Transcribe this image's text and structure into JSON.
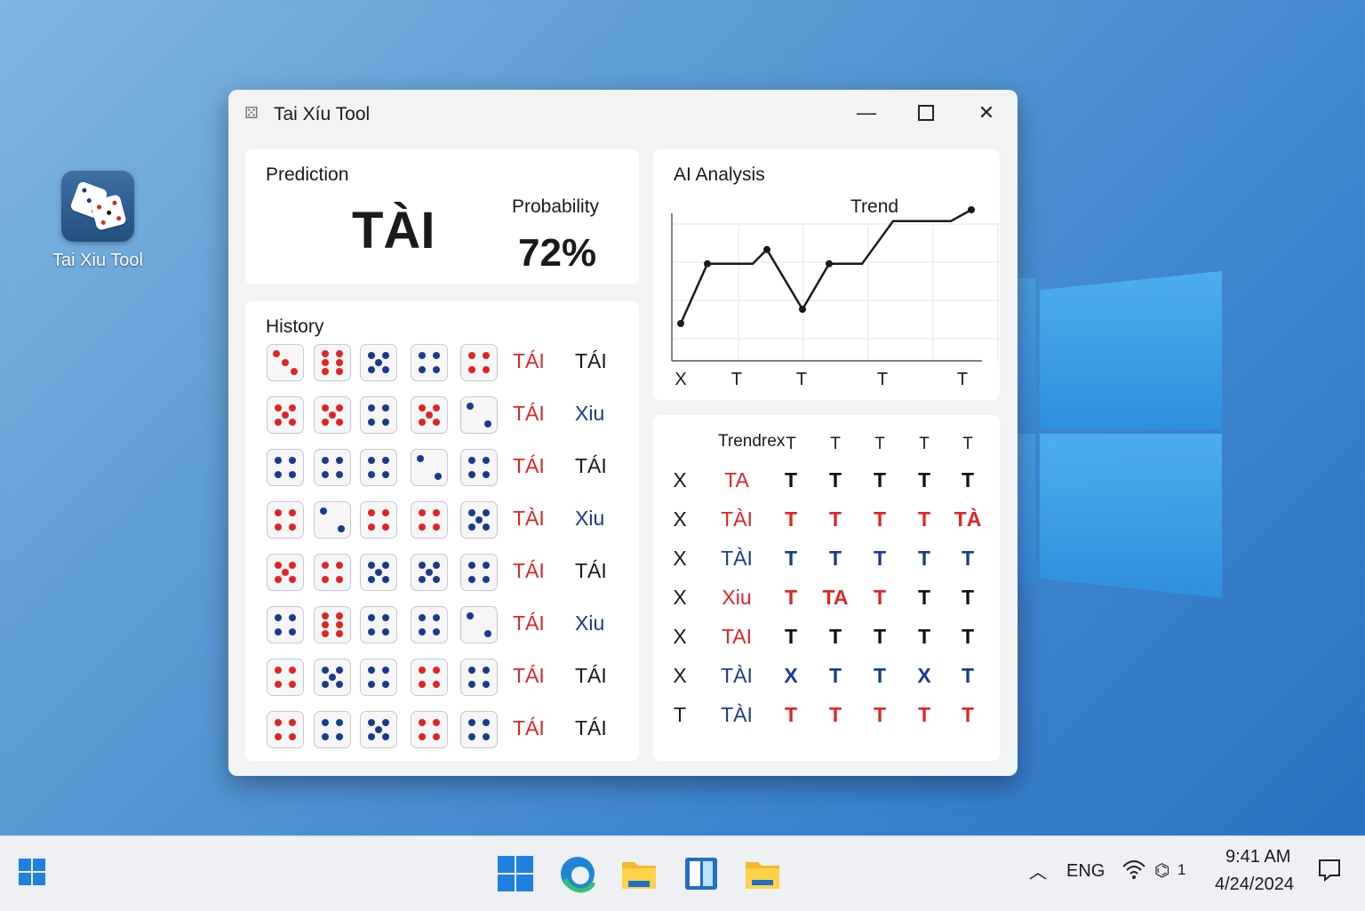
{
  "desktop": {
    "icon_label": "Tai Xiu Tool"
  },
  "window": {
    "title": "Tai Xíu Tool",
    "controls": {
      "minimize": "—",
      "close": "✕"
    }
  },
  "prediction": {
    "title": "Prediction",
    "value": "TÀI",
    "probability_label": "Probability",
    "probability": "72%"
  },
  "history": {
    "title": "History",
    "rows": [
      {
        "dice": [
          2,
          6,
          5,
          4,
          4
        ],
        "colors": [
          "r",
          "r",
          "b",
          "b",
          "r"
        ],
        "result": "TÁI",
        "label": "TÁI",
        "label_color": "#1a1a1a"
      },
      {
        "dice": [
          5,
          5,
          4,
          5,
          2
        ],
        "colors": [
          "r",
          "r",
          "b",
          "r",
          "b"
        ],
        "result": "TÁI",
        "label": "Xiu",
        "label_color": "#1a3a8a"
      },
      {
        "dice": [
          4,
          4,
          4,
          2,
          4
        ],
        "colors": [
          "b",
          "b",
          "b",
          "b",
          "b"
        ],
        "result": "TÁI",
        "label": "TÁI",
        "label_color": "#1a1a1a"
      },
      {
        "dice": [
          4,
          2,
          4,
          4,
          5
        ],
        "colors": [
          "r",
          "b",
          "r",
          "r",
          "b"
        ],
        "result": "TÀI",
        "label": "Xiu",
        "label_color": "#1a3a8a"
      },
      {
        "dice": [
          5,
          4,
          5,
          5,
          4
        ],
        "colors": [
          "r",
          "r",
          "b",
          "b",
          "b"
        ],
        "result": "TÁI",
        "label": "TÁI",
        "label_color": "#1a1a1a"
      },
      {
        "dice": [
          4,
          6,
          4,
          4,
          2
        ],
        "colors": [
          "b",
          "r",
          "b",
          "b",
          "b"
        ],
        "result": "TÁI",
        "label": "Xiu",
        "label_color": "#1a3a8a"
      },
      {
        "dice": [
          4,
          5,
          4,
          4,
          4
        ],
        "colors": [
          "r",
          "b",
          "b",
          "r",
          "b"
        ],
        "result": "TÁI",
        "label": "TÁI",
        "label_color": "#1a1a1a"
      },
      {
        "dice": [
          4,
          4,
          5,
          4,
          4
        ],
        "colors": [
          "r",
          "b",
          "b",
          "r",
          "b"
        ],
        "result": "TÁI",
        "label": "TÁI",
        "label_color": "#1a1a1a"
      }
    ]
  },
  "ai_analysis": {
    "title": "AI Analysis",
    "chart_data": {
      "type": "line",
      "title": "Trend",
      "x_tick_labels": [
        "X",
        "T",
        "T",
        "T",
        "T"
      ],
      "values": [
        0.1,
        0.52,
        0.52,
        0.62,
        0.2,
        0.52,
        0.52,
        0.82,
        0.82,
        0.9
      ],
      "ylim": [
        0,
        1
      ],
      "grid": true
    }
  },
  "trend": {
    "title": "Trendrex",
    "header": [
      "T",
      "T",
      "T",
      "T",
      "T"
    ],
    "rows": [
      {
        "first": "X",
        "label": "TA",
        "label_color": "#e02424",
        "cells": [
          "T",
          "T",
          "T",
          "T",
          "T"
        ],
        "colors": [
          "#111",
          "#111",
          "#111",
          "#111",
          "#111"
        ]
      },
      {
        "first": "X",
        "label": "TÀI",
        "label_color": "#e02424",
        "cells": [
          "T",
          "T",
          "T",
          "T",
          "TÀ"
        ],
        "colors": [
          "#e02424",
          "#e02424",
          "#e02424",
          "#e02424",
          "#e02424"
        ]
      },
      {
        "first": "X",
        "label": "TÀI",
        "label_color": "#1a3a8a",
        "cells": [
          "T",
          "T",
          "T",
          "T",
          "T"
        ],
        "colors": [
          "#1a3a8a",
          "#1a3a8a",
          "#1a3a8a",
          "#1a3a8a",
          "#1a3a8a"
        ]
      },
      {
        "first": "X",
        "label": "Xiu",
        "label_color": "#e02424",
        "cells": [
          "T",
          "TA",
          "T",
          "T",
          "T"
        ],
        "colors": [
          "#e02424",
          "#e02424",
          "#e02424",
          "#111",
          "#111"
        ]
      },
      {
        "first": "X",
        "label": "TAI",
        "label_color": "#e02424",
        "cells": [
          "T",
          "T",
          "T",
          "T",
          "T"
        ],
        "colors": [
          "#111",
          "#111",
          "#111",
          "#111",
          "#111"
        ]
      },
      {
        "first": "X",
        "label": "TÀI",
        "label_color": "#1a3a8a",
        "cells": [
          "X",
          "T",
          "T",
          "X",
          "T"
        ],
        "colors": [
          "#1a3a8a",
          "#1a3a8a",
          "#1a3a8a",
          "#1a3a8a",
          "#1a3a8a"
        ]
      },
      {
        "first": "T",
        "label": "TÀI",
        "label_color": "#1a3a8a",
        "cells": [
          "T",
          "T",
          "T",
          "T",
          "T"
        ],
        "colors": [
          "#e02424",
          "#e02424",
          "#e02424",
          "#e02424",
          "#e02424"
        ]
      }
    ]
  },
  "taskbar": {
    "language": "ENG",
    "time": "9:41 AM",
    "date": "4/24/2024",
    "badge": "1",
    "icons": [
      "start-icon",
      "windows-icon",
      "edge-icon",
      "file-explorer-icon",
      "store-icon",
      "folder-icon"
    ]
  },
  "colors": {
    "red": "#e02424",
    "navy": "#1a3a8a",
    "accent": "#1e80e0"
  }
}
